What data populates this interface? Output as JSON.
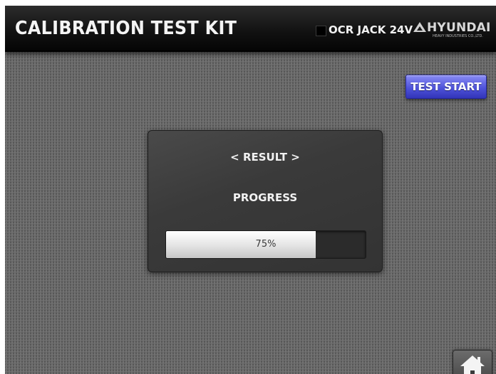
{
  "header": {
    "title": "CALIBRATION TEST KIT",
    "device_label": "OCR JACK 24V",
    "brand_name": "HYUNDAI",
    "brand_tagline": "HEAVY INDUSTRIES CO.,LTD."
  },
  "actions": {
    "start_label": "TEST START"
  },
  "result": {
    "title": "< RESULT >",
    "progress_label": "PROGRESS",
    "progress_text": "75%",
    "progress_fraction": 0.75
  },
  "icons": {
    "device_indicator": "square-indicator-icon",
    "brand": "hyundai-logo-icon",
    "home": "home-icon"
  },
  "colors": {
    "header_bg": "#111111",
    "background": "#6a6a6a",
    "start_button": "#4f53da",
    "progress_fill": "#e6e6e6",
    "progress_track": "#2b2b2b",
    "text": "#f2f2f2"
  }
}
